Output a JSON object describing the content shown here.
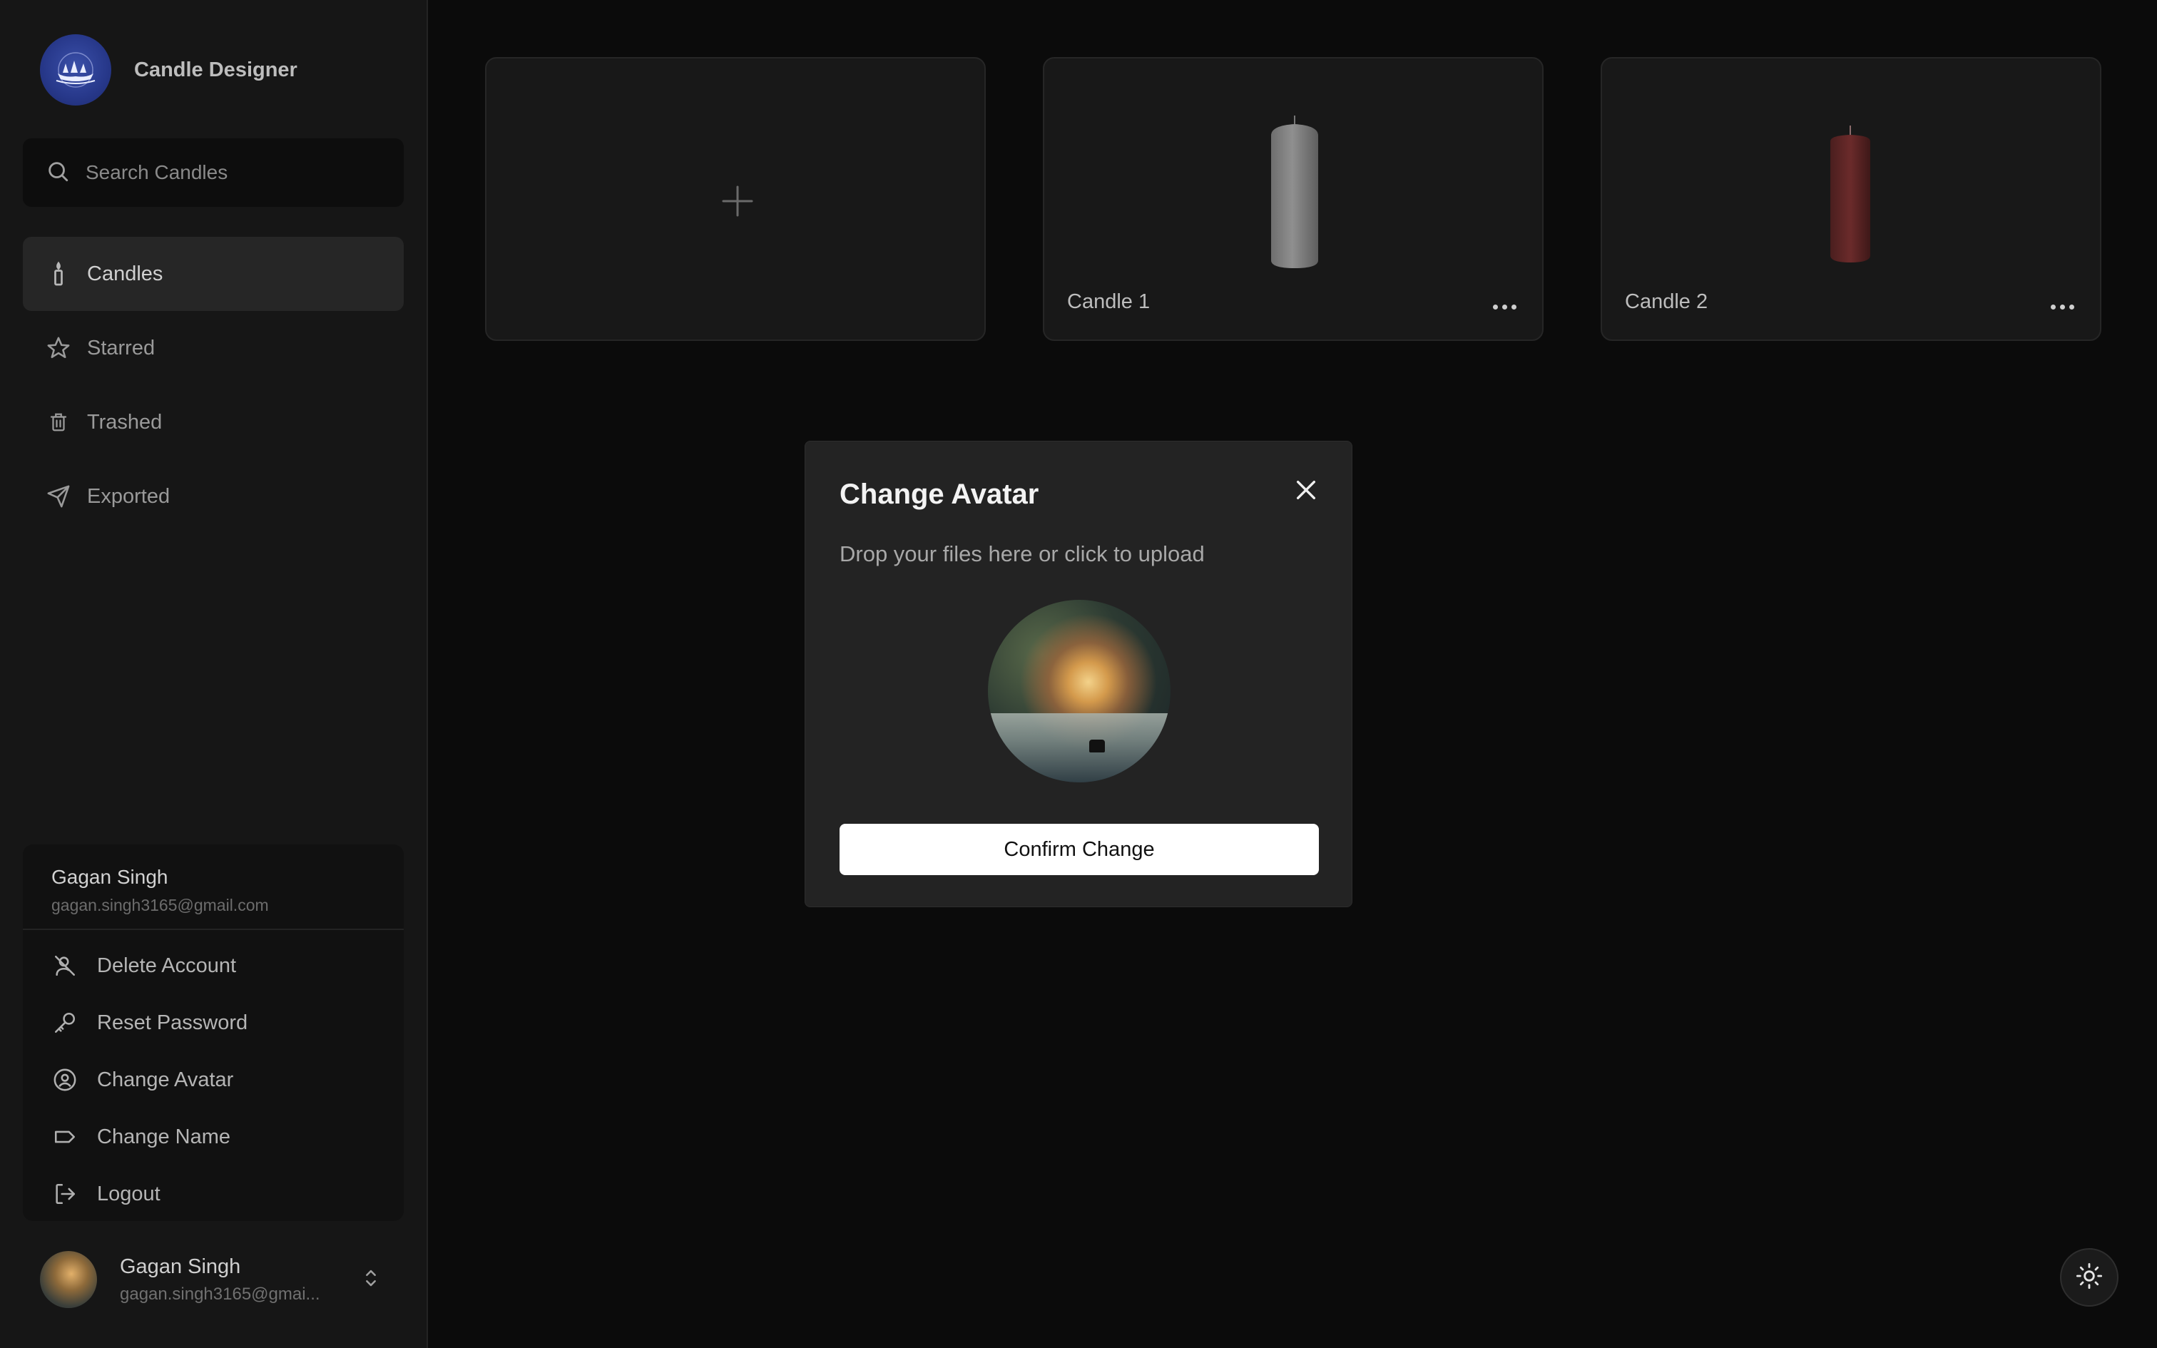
{
  "app": {
    "name": "Candle Designer"
  },
  "search": {
    "placeholder": "Search Candles"
  },
  "nav": [
    {
      "label": "Candles",
      "icon": "candle-icon",
      "active": true
    },
    {
      "label": "Starred",
      "icon": "star-icon"
    },
    {
      "label": "Trashed",
      "icon": "trash-icon"
    },
    {
      "label": "Exported",
      "icon": "send-icon"
    }
  ],
  "account": {
    "name": "Gagan Singh",
    "email": "gagan.singh3165@gmail.com",
    "menu": [
      {
        "label": "Delete Account",
        "icon": "user-x-icon"
      },
      {
        "label": "Reset Password",
        "icon": "key-icon"
      },
      {
        "label": "Change Avatar",
        "icon": "user-circle-icon"
      },
      {
        "label": "Change Name",
        "icon": "tag-icon"
      },
      {
        "label": "Logout",
        "icon": "logout-icon"
      }
    ]
  },
  "footer": {
    "name": "Gagan Singh",
    "email": "gagan.singh3165@gmai..."
  },
  "cards": [
    {
      "label": "",
      "type": "new"
    },
    {
      "label": "Candle 1",
      "color": "#8a8a8a"
    },
    {
      "label": "Candle 2",
      "color": "#6a2a2a"
    }
  ],
  "modal": {
    "title": "Change Avatar",
    "subtitle": "Drop your files here or click to upload",
    "confirm_label": "Confirm Change"
  },
  "colors": {
    "background": "#0b0b0b",
    "sidebar": "#161616",
    "modal": "#232323",
    "button": "#ffffff"
  }
}
